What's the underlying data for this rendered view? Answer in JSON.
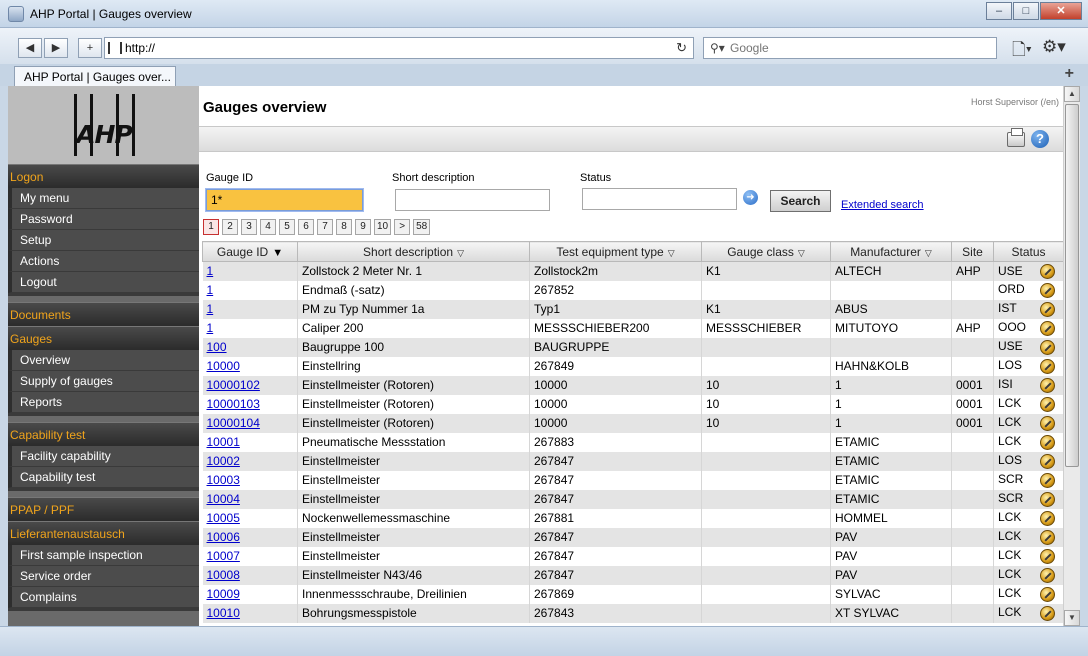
{
  "window": {
    "title": "AHP Portal | Gauges overview",
    "tab_title": "AHP Portal | Gauges over...",
    "url": "http://",
    "search_placeholder": "Google"
  },
  "sidebar": {
    "logo_text": "AHP",
    "sections": [
      {
        "title": "Logon",
        "items": [
          "My menu",
          "Password",
          "Setup",
          "Actions",
          "Logout"
        ]
      },
      {
        "title": "Documents",
        "items": []
      },
      {
        "title": "Gauges",
        "items": [
          "Overview",
          "Supply of gauges",
          "Reports"
        ]
      },
      {
        "title": "Capability test",
        "items": [
          "Facility capability",
          "Capability test"
        ]
      },
      {
        "title": "PPAP / PPF",
        "items": []
      },
      {
        "title": "Lieferantenaustausch",
        "items": [
          "First sample inspection",
          "Service order",
          "Complains"
        ]
      }
    ]
  },
  "main": {
    "title": "Gauges overview",
    "user": "Horst Supervisor (/en)",
    "filters": {
      "gauge_id_label": "Gauge ID",
      "gauge_id_value": "1*",
      "short_desc_label": "Short description",
      "short_desc_value": "",
      "status_label": "Status",
      "status_value": "",
      "search_button": "Search",
      "extended_link": "Extended search"
    },
    "pager": [
      "1",
      "2",
      "3",
      "4",
      "5",
      "6",
      "7",
      "8",
      "9",
      "10",
      ">",
      "58"
    ],
    "table": {
      "columns": [
        "Gauge ID",
        "Short description",
        "Test equipment type",
        "Gauge class",
        "Manufacturer",
        "Site",
        "Status"
      ],
      "rows": [
        [
          "1",
          "Zollstock 2 Meter Nr. 1",
          "Zollstock2m",
          "K1",
          "ALTECH",
          "AHP",
          "USE"
        ],
        [
          "1",
          "Endmaß (-satz)",
          "267852",
          "",
          "",
          "",
          "ORD"
        ],
        [
          "1",
          "PM zu Typ Nummer 1a",
          "Typ1",
          "K1",
          "ABUS",
          "",
          "IST"
        ],
        [
          "1",
          "Caliper 200",
          "MESSSCHIEBER200",
          "MESSSCHIEBER",
          "MITUTOYO",
          "AHP",
          "OOO"
        ],
        [
          "100",
          "Baugruppe 100",
          "BAUGRUPPE",
          "",
          "",
          "",
          "USE"
        ],
        [
          "10000",
          "Einstellring",
          "267849",
          "",
          "HAHN&KOLB",
          "",
          "LOS"
        ],
        [
          "10000102",
          "Einstellmeister (Rotoren)",
          "10000",
          "10",
          "1",
          "0001",
          "ISI"
        ],
        [
          "10000103",
          "Einstellmeister (Rotoren)",
          "10000",
          "10",
          "1",
          "0001",
          "LCK"
        ],
        [
          "10000104",
          "Einstellmeister (Rotoren)",
          "10000",
          "10",
          "1",
          "0001",
          "LCK"
        ],
        [
          "10001",
          "Pneumatische Messstation",
          "267883",
          "",
          "ETAMIC",
          "",
          "LCK"
        ],
        [
          "10002",
          "Einstellmeister",
          "267847",
          "",
          "ETAMIC",
          "",
          "LOS"
        ],
        [
          "10003",
          "Einstellmeister",
          "267847",
          "",
          "ETAMIC",
          "",
          "SCR"
        ],
        [
          "10004",
          "Einstellmeister",
          "267847",
          "",
          "ETAMIC",
          "",
          "SCR"
        ],
        [
          "10005",
          "Nockenwellemessmaschine",
          "267881",
          "",
          "HOMMEL",
          "",
          "LCK"
        ],
        [
          "10006",
          "Einstellmeister",
          "267847",
          "",
          "PAV",
          "",
          "LCK"
        ],
        [
          "10007",
          "Einstellmeister",
          "267847",
          "",
          "PAV",
          "",
          "LCK"
        ],
        [
          "10008",
          "Einstellmeister N43/46",
          "267847",
          "",
          "PAV",
          "",
          "LCK"
        ],
        [
          "10009",
          "Innenmessschraube, Dreilinien",
          "267869",
          "",
          "SYLVAC",
          "",
          "LCK"
        ],
        [
          "10010",
          "Bohrungsmesspistole",
          "267843",
          "",
          "XT SYLVAC",
          "",
          "LCK"
        ]
      ]
    }
  }
}
